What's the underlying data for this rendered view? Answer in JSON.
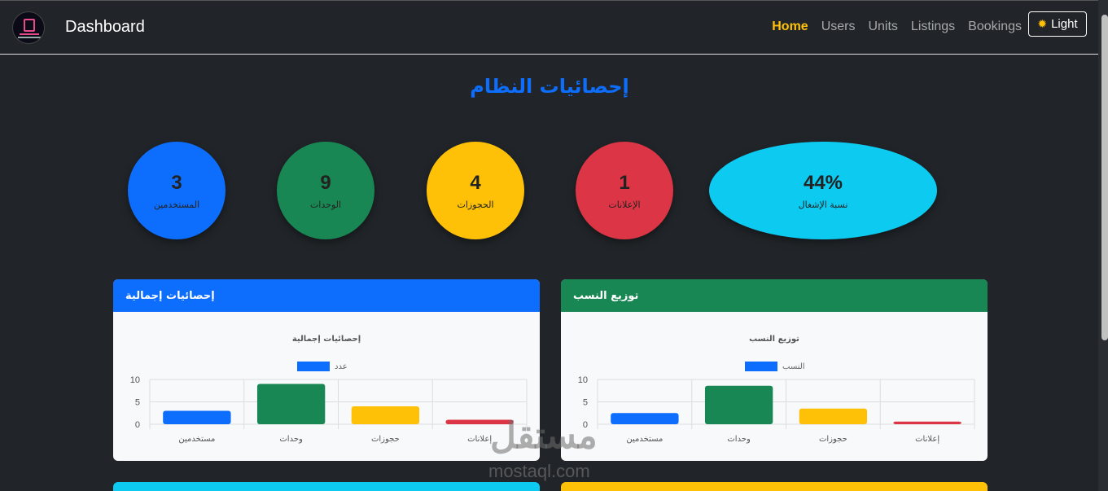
{
  "navbar": {
    "brand": "Dashboard",
    "links": [
      {
        "label": "Home",
        "active": true
      },
      {
        "label": "Users",
        "active": false
      },
      {
        "label": "Units",
        "active": false
      },
      {
        "label": "Listings",
        "active": false
      },
      {
        "label": "Bookings",
        "active": false
      }
    ],
    "theme_button": {
      "icon": "sun-icon",
      "label": "Light"
    }
  },
  "page_title": "إحصائيات النظام",
  "stats": [
    {
      "value": "3",
      "label": "المستخدمين",
      "color": "#0d6efd"
    },
    {
      "value": "9",
      "label": "الوحدات",
      "color": "#198754"
    },
    {
      "value": "4",
      "label": "الحجوزات",
      "color": "#ffc107"
    },
    {
      "value": "1",
      "label": "الإعلانات",
      "color": "#dc3545"
    },
    {
      "value": "44%",
      "label": "نسبة الإشغال",
      "color": "#0dcaf0"
    }
  ],
  "cards": [
    {
      "header": "إحصائيات إجمالية",
      "header_color": "#0d6efd"
    },
    {
      "header": "توزيع النسب",
      "header_color": "#198754"
    }
  ],
  "bottom_cards": [
    {
      "color": "#0dcaf0"
    },
    {
      "color": "#ffc107"
    }
  ],
  "watermark": {
    "arabic": "مستقل",
    "latin": "mostaql.com"
  },
  "chart_data": [
    {
      "type": "bar",
      "title": "إحصائيات إجمالية",
      "categories": [
        "مستخدمين",
        "وحدات",
        "حجوزات",
        "إعلانات"
      ],
      "series": [
        {
          "name": "عدد",
          "values": [
            3,
            9,
            4,
            1
          ]
        }
      ],
      "bar_colors": [
        "#0d6efd",
        "#198754",
        "#ffc107",
        "#dc3545"
      ],
      "legend_color": "#0d6efd",
      "legend": "top",
      "ylim": [
        0,
        10
      ],
      "yticks": [
        0,
        5,
        10
      ],
      "grid": true
    },
    {
      "type": "bar",
      "title": "توزيع النسب",
      "categories": [
        "مستخدمين",
        "وحدات",
        "حجوزات",
        "إعلانات"
      ],
      "series": [
        {
          "name": "النسب",
          "values": [
            2.5,
            8.6,
            3.5,
            0.6
          ]
        }
      ],
      "bar_colors": [
        "#0d6efd",
        "#198754",
        "#ffc107",
        "#dc3545"
      ],
      "legend_color": "#0d6efd",
      "legend": "top",
      "ylim": [
        0,
        10
      ],
      "yticks": [
        0,
        5,
        10
      ],
      "grid": true
    }
  ]
}
